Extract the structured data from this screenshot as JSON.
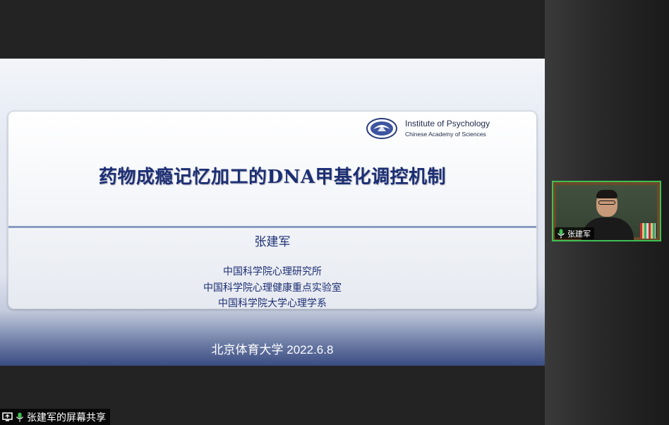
{
  "slide": {
    "logo": {
      "line1": "Institute of Psychology",
      "line2": "Chinese Academy of Sciences"
    },
    "title": "药物成瘾记忆加工的DNA甲基化调控机制",
    "author": "张建军",
    "affiliations": [
      "中国科学院心理研究所",
      "中国科学院心理健康重点实验室",
      "中国科学院大学心理学系"
    ],
    "venue": "北京体育大学 2022.6.8"
  },
  "participant": {
    "name": "张建军",
    "mic_icon": "mic-icon"
  },
  "share_bar": {
    "label": "张建军的屏幕共享",
    "icons": [
      "screen-share-icon",
      "mic-icon"
    ]
  },
  "colors": {
    "title": "#1c2f74",
    "active_speaker_border": "#3fbf53",
    "mic_green": "#3fbf53"
  }
}
